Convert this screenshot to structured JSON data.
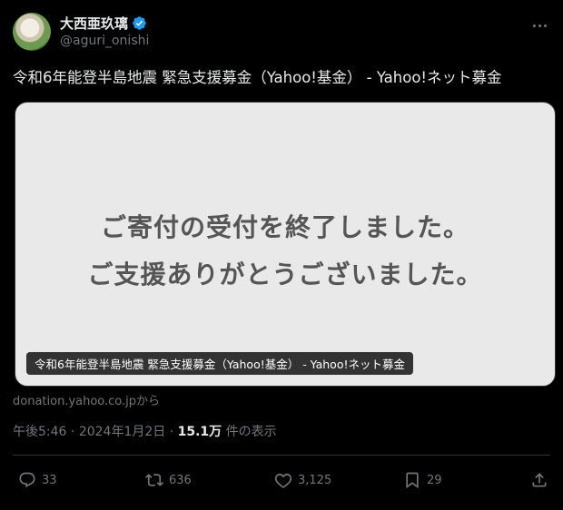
{
  "author": {
    "name": "大西亜玖璃",
    "handle": "@aguri_onishi"
  },
  "tweet": {
    "text": "令和6年能登半島地震 緊急支援募金（Yahoo!基金） - Yahoo!ネット募金"
  },
  "card": {
    "message_line1": "ご寄付の受付を終了しました。",
    "message_line2": "ご支援ありがとうございました。",
    "title": "令和6年能登半島地震 緊急支援募金（Yahoo!基金） - Yahoo!ネット募金",
    "source": "donation.yahoo.co.jpから"
  },
  "meta": {
    "time": "午後5:46",
    "separator": "·",
    "date": "2024年1月2日",
    "separator2": "·",
    "views_count": "15.1万",
    "views_label": "件の表示"
  },
  "actions": {
    "replies": "33",
    "reposts": "636",
    "likes": "3,125",
    "bookmarks": "29"
  },
  "colors": {
    "background": "#000000",
    "text": "#e7e9ea",
    "muted": "#71767b",
    "verified": "#1d9bf0",
    "card_bg": "#e9e9e9"
  }
}
